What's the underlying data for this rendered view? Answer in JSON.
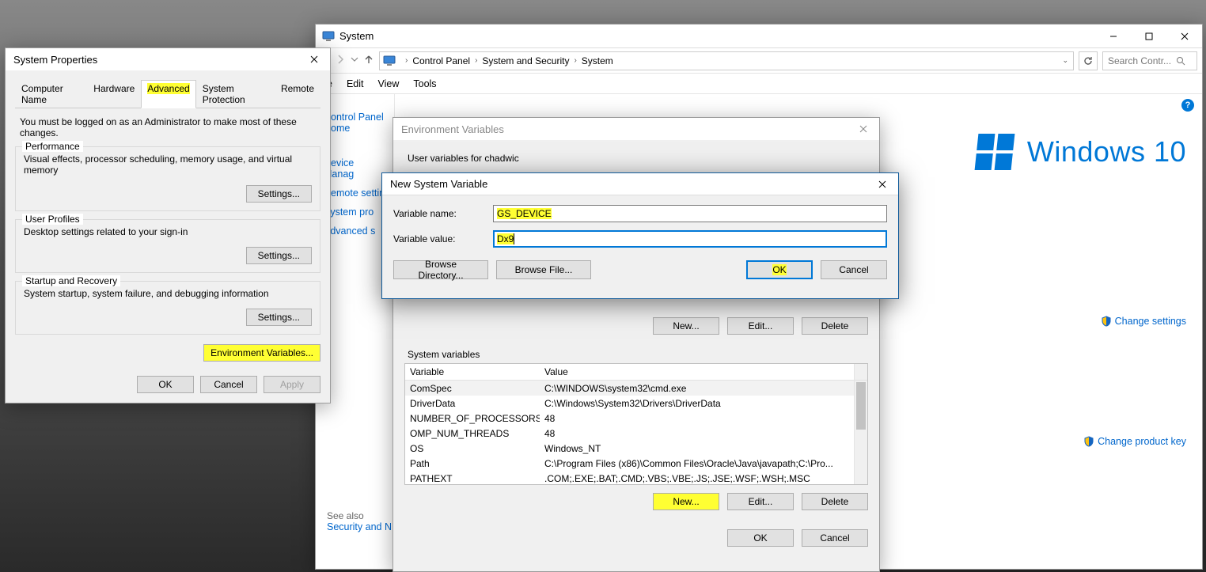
{
  "sysprops": {
    "title": "System Properties",
    "tabs": [
      "Computer Name",
      "Hardware",
      "Advanced",
      "System Protection",
      "Remote"
    ],
    "active_tab": 2,
    "note": "You must be logged on as an Administrator to make most of these changes.",
    "perf_title": "Performance",
    "perf_desc": "Visual effects, processor scheduling, memory usage, and virtual memory",
    "profiles_title": "User Profiles",
    "profiles_desc": "Desktop settings related to your sign-in",
    "startup_title": "Startup and Recovery",
    "startup_desc": "System startup, system failure, and debugging information",
    "settings_label": "Settings...",
    "envvar_btn": "Environment Variables...",
    "ok": "OK",
    "cancel": "Cancel",
    "apply": "Apply"
  },
  "cp": {
    "title": "System",
    "breadcrumb": [
      "Control Panel",
      "System and Security",
      "System"
    ],
    "search_placeholder": "Search Contr...",
    "menus": [
      "e",
      "Edit",
      "View",
      "Tools"
    ],
    "home": "Control Panel Home",
    "left_links": [
      "Device Manag",
      "Remote settin",
      "System pro",
      "Advanced s"
    ],
    "brand": "Windows 10",
    "change_settings": "Change settings",
    "change_product_key": "Change product key",
    "see_also": "See also",
    "security_link": "Security and N"
  },
  "envvars": {
    "title": "Environment Variables",
    "user_label": "User variables for chadwic",
    "sys_label": "System variables",
    "cols": {
      "name": "Variable",
      "value": "Value"
    },
    "sys_rows": [
      {
        "name": "ComSpec",
        "value": "C:\\WINDOWS\\system32\\cmd.exe"
      },
      {
        "name": "DriverData",
        "value": "C:\\Windows\\System32\\Drivers\\DriverData"
      },
      {
        "name": "NUMBER_OF_PROCESSORS",
        "value": "48"
      },
      {
        "name": "OMP_NUM_THREADS",
        "value": "48"
      },
      {
        "name": "OS",
        "value": "Windows_NT"
      },
      {
        "name": "Path",
        "value": "C:\\Program Files (x86)\\Common Files\\Oracle\\Java\\javapath;C:\\Pro..."
      },
      {
        "name": "PATHEXT",
        "value": ".COM;.EXE;.BAT;.CMD;.VBS;.VBE;.JS;.JSE;.WSF;.WSH;.MSC"
      }
    ],
    "new": "New...",
    "edit": "Edit...",
    "delete": "Delete",
    "ok": "OK",
    "cancel": "Cancel"
  },
  "newvar": {
    "title": "New System Variable",
    "name_label": "Variable name:",
    "value_label": "Variable value:",
    "name_value": "GS_DEVICE",
    "value_value": "Dx9",
    "browse_dir": "Browse Directory...",
    "browse_file": "Browse File...",
    "ok": "OK",
    "cancel": "Cancel"
  },
  "icons": {
    "close_label": "Close",
    "min_label": "Minimize",
    "max_label": "Maximize"
  }
}
